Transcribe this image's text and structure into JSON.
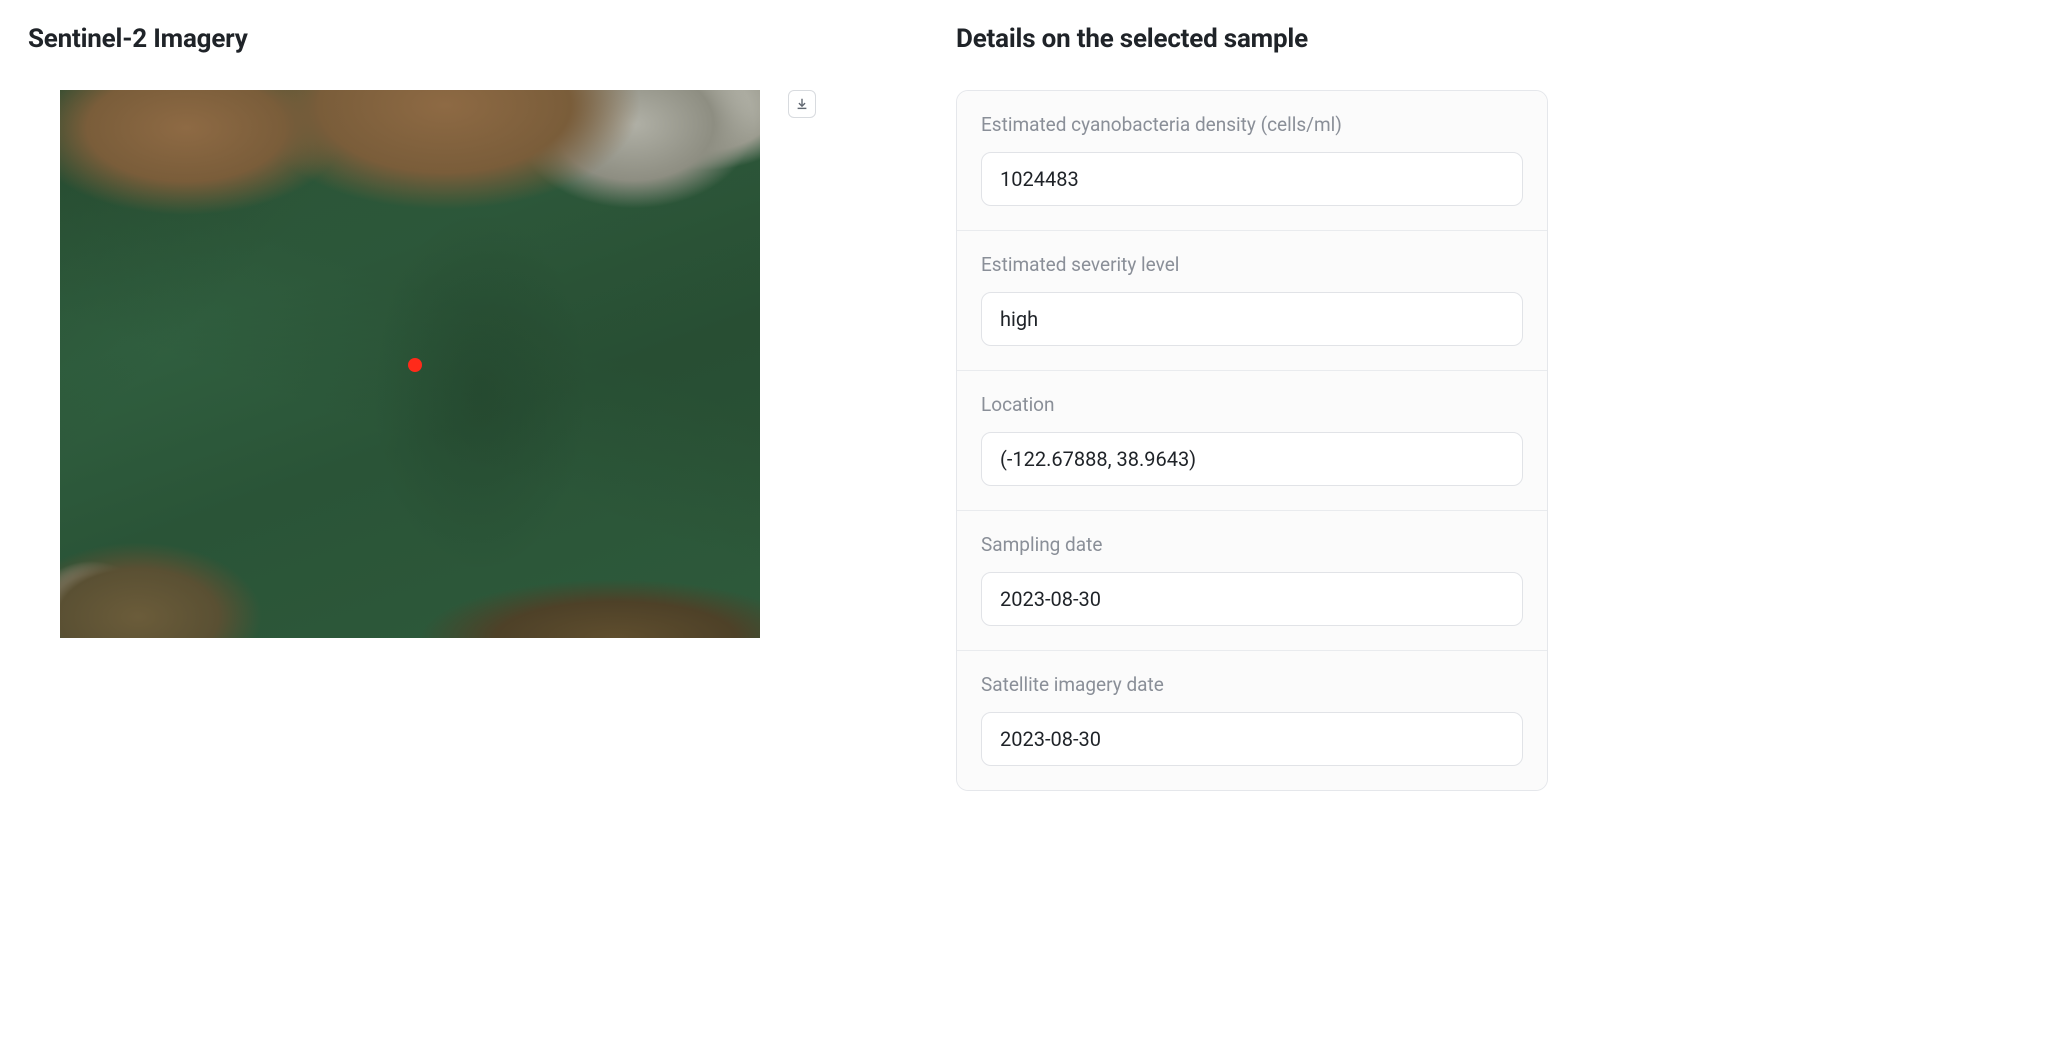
{
  "left": {
    "title": "Sentinel-2 Imagery"
  },
  "right": {
    "title": "Details on the selected sample"
  },
  "fields": {
    "density": {
      "label": "Estimated cyanobacteria density (cells/ml)",
      "value": "1024483"
    },
    "severity": {
      "label": "Estimated severity level",
      "value": "high"
    },
    "location": {
      "label": "Location",
      "value": "(-122.67888, 38.9643)"
    },
    "sampling_date": {
      "label": "Sampling date",
      "value": "2023-08-30"
    },
    "imagery_date": {
      "label": "Satellite imagery date",
      "value": "2023-08-30"
    }
  }
}
